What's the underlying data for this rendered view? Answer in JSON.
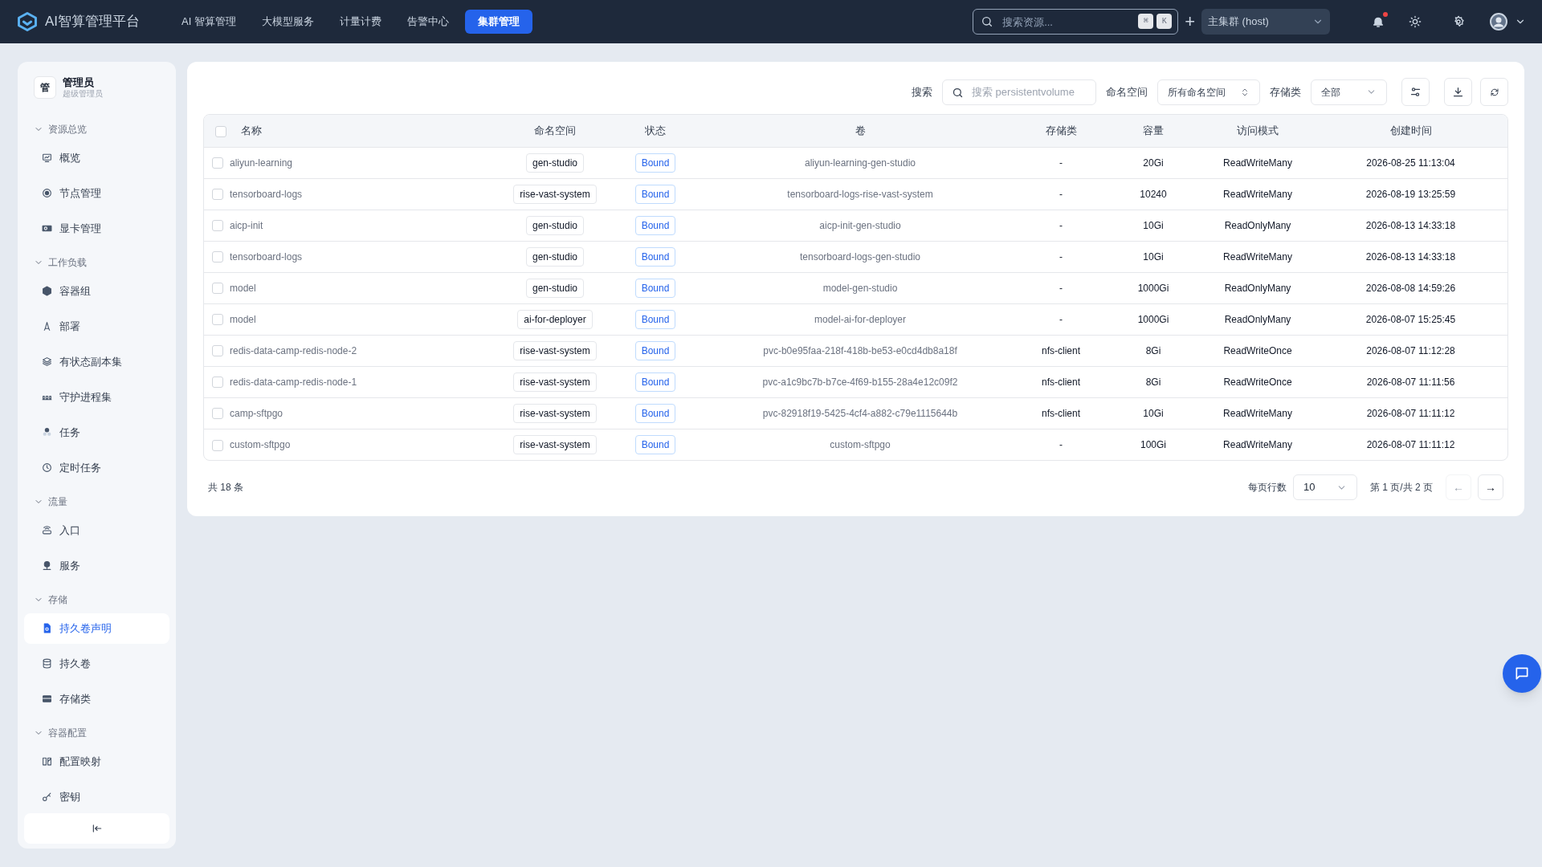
{
  "topbar": {
    "brand": "AI智算管理平台",
    "nav": [
      {
        "label": "AI 智算管理",
        "selected": false
      },
      {
        "label": "大模型服务",
        "selected": false
      },
      {
        "label": "计量计费",
        "selected": false
      },
      {
        "label": "告警中心",
        "selected": false
      },
      {
        "label": "集群管理",
        "selected": true
      }
    ],
    "search": {
      "placeholder": "搜索资源...",
      "keys": [
        "⌘",
        "K"
      ]
    },
    "add": "+",
    "cluster": "主集群 (host)",
    "notification_dot": true
  },
  "sidebar": {
    "user": {
      "avatar": "管",
      "name": "管理员",
      "role": "超级管理员"
    },
    "groups": [
      {
        "label": "资源总览",
        "expanded": true,
        "items": [
          {
            "label": "概览",
            "selected": false
          },
          {
            "label": "节点管理",
            "selected": false
          },
          {
            "label": "显卡管理",
            "selected": false
          }
        ]
      },
      {
        "label": "工作负载",
        "expanded": true,
        "items": [
          {
            "label": "容器组",
            "selected": false
          },
          {
            "label": "部署",
            "selected": false
          },
          {
            "label": "有状态副本集",
            "selected": false
          },
          {
            "label": "守护进程集",
            "selected": false
          },
          {
            "label": "任务",
            "selected": false
          },
          {
            "label": "定时任务",
            "selected": false
          }
        ]
      },
      {
        "label": "流量",
        "expanded": true,
        "items": [
          {
            "label": "入口",
            "selected": false
          },
          {
            "label": "服务",
            "selected": false
          }
        ]
      },
      {
        "label": "存储",
        "expanded": true,
        "items": [
          {
            "label": "持久卷声明",
            "selected": true
          },
          {
            "label": "持久卷",
            "selected": false
          },
          {
            "label": "存储类",
            "selected": false
          }
        ]
      },
      {
        "label": "容器配置",
        "expanded": true,
        "items": [
          {
            "label": "配置映射",
            "selected": false
          },
          {
            "label": "密钥",
            "selected": false
          }
        ]
      }
    ]
  },
  "filters": {
    "search_label": "搜索",
    "search_placeholder": "搜索 persistentvolume",
    "namespace_label": "命名空间",
    "namespace_value": "所有命名空间",
    "storageclass_label": "存储类",
    "storageclass_value": "全部"
  },
  "table": {
    "select_all_checked": false,
    "columns": [
      "名称",
      "命名空间",
      "状态",
      "卷",
      "存储类",
      "容量",
      "访问模式",
      "创建时间"
    ],
    "rows": [
      {
        "checked": false,
        "cells": [
          "aliyun-learning",
          "gen-studio",
          "Bound",
          "aliyun-learning-gen-studio",
          "-",
          "20Gi",
          "ReadWriteMany",
          "2026-08-25 11:13:04"
        ]
      },
      {
        "checked": false,
        "cells": [
          "tensorboard-logs",
          "rise-vast-system",
          "Bound",
          "tensorboard-logs-rise-vast-system",
          "-",
          "10240",
          "ReadWriteMany",
          "2026-08-19 13:25:59"
        ]
      },
      {
        "checked": false,
        "cells": [
          "aicp-init",
          "gen-studio",
          "Bound",
          "aicp-init-gen-studio",
          "-",
          "10Gi",
          "ReadOnlyMany",
          "2026-08-13 14:33:18"
        ]
      },
      {
        "checked": false,
        "cells": [
          "tensorboard-logs",
          "gen-studio",
          "Bound",
          "tensorboard-logs-gen-studio",
          "-",
          "10Gi",
          "ReadWriteMany",
          "2026-08-13 14:33:18"
        ]
      },
      {
        "checked": false,
        "cells": [
          "model",
          "gen-studio",
          "Bound",
          "model-gen-studio",
          "-",
          "1000Gi",
          "ReadOnlyMany",
          "2026-08-08 14:59:26"
        ]
      },
      {
        "checked": false,
        "cells": [
          "model",
          "ai-for-deployer",
          "Bound",
          "model-ai-for-deployer",
          "-",
          "1000Gi",
          "ReadOnlyMany",
          "2026-08-07 15:25:45"
        ]
      },
      {
        "checked": false,
        "cells": [
          "redis-data-camp-redis-node-2",
          "rise-vast-system",
          "Bound",
          "pvc-b0e95faa-218f-418b-be53-e0cd4db8a18f",
          "nfs-client",
          "8Gi",
          "ReadWriteOnce",
          "2026-08-07 11:12:28"
        ]
      },
      {
        "checked": false,
        "cells": [
          "redis-data-camp-redis-node-1",
          "rise-vast-system",
          "Bound",
          "pvc-a1c9bc7b-b7ce-4f69-b155-28a4e12c09f2",
          "nfs-client",
          "8Gi",
          "ReadWriteOnce",
          "2026-08-07 11:11:56"
        ]
      },
      {
        "checked": false,
        "cells": [
          "camp-sftpgo",
          "rise-vast-system",
          "Bound",
          "pvc-82918f19-5425-4cf4-a882-c79e1115644b",
          "nfs-client",
          "10Gi",
          "ReadWriteMany",
          "2026-08-07 11:11:12"
        ]
      },
      {
        "checked": false,
        "cells": [
          "custom-sftpgo",
          "rise-vast-system",
          "Bound",
          "custom-sftpgo",
          "-",
          "100Gi",
          "ReadWriteMany",
          "2026-08-07 11:11:12"
        ]
      }
    ]
  },
  "footer": {
    "total": "共 18 条",
    "rows_label": "每页行数",
    "rows_value": "10",
    "page": "第 1 页/共 2 页",
    "prev": {
      "label": "←",
      "disabled": true
    },
    "next": {
      "label": "→",
      "disabled": false
    }
  }
}
